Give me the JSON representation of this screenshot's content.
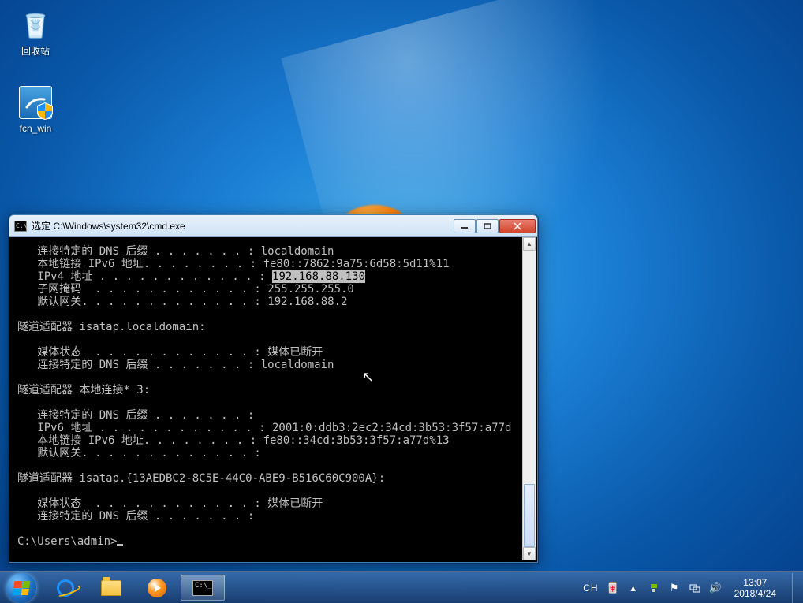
{
  "desktop": {
    "icons": [
      {
        "name": "recycle-bin",
        "label": "回收站"
      },
      {
        "name": "fcn-win",
        "label": "fcn_win"
      }
    ]
  },
  "cmd": {
    "title": "选定 C:\\Windows\\system32\\cmd.exe",
    "highlighted_ip": "192.168.88.130",
    "prompt": "C:\\Users\\admin>",
    "lines_pre": "   连接特定的 DNS 后缀 . . . . . . . : localdomain\n   本地链接 IPv6 地址. . . . . . . . : fe80::7862:9a75:6d58:5d11%11\n   IPv4 地址 . . . . . . . . . . . . : ",
    "lines_post": "\n   子网掩码  . . . . . . . . . . . . : 255.255.255.0\n   默认网关. . . . . . . . . . . . . : 192.168.88.2\n\n隧道适配器 isatap.localdomain:\n\n   媒体状态  . . . . . . . . . . . . : 媒体已断开\n   连接特定的 DNS 后缀 . . . . . . . : localdomain\n\n隧道适配器 本地连接* 3:\n\n   连接特定的 DNS 后缀 . . . . . . . :\n   IPv6 地址 . . . . . . . . . . . . : 2001:0:ddb3:2ec2:34cd:3b53:3f57:a77d\n   本地链接 IPv6 地址. . . . . . . . : fe80::34cd:3b53:3f57:a77d%13\n   默认网关. . . . . . . . . . . . . :\n\n隧道适配器 isatap.{13AEDBC2-8C5E-44C0-ABE9-B516C60C900A}:\n\n   媒体状态  . . . . . . . . . . . . : 媒体已断开\n   连接特定的 DNS 后缀 . . . . . . . :\n\n"
  },
  "taskbar": {
    "pins": [
      "internet-explorer",
      "file-explorer",
      "windows-media-player",
      "cmd"
    ]
  },
  "tray": {
    "language": "CH",
    "icons": [
      "ime-icon",
      "chevron-up-icon",
      "safely-remove-icon",
      "action-center-icon",
      "network-icon",
      "volume-icon"
    ],
    "time": "13:07",
    "date": "2018/4/24"
  }
}
